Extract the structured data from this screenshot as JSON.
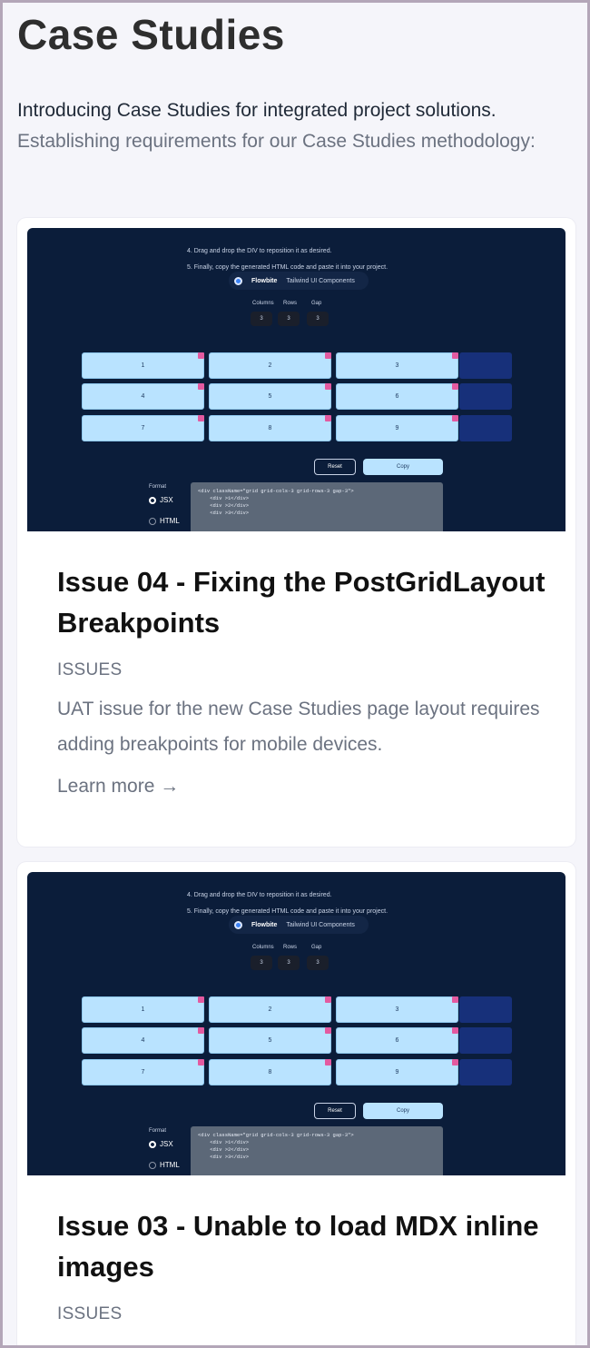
{
  "page": {
    "title": "Case Studies",
    "intro_lead": "Introducing Case Studies for integrated project solutions.",
    "intro_muted": "Establishing requirements for our Case Studies methodology:"
  },
  "screenshot": {
    "step4": "4. Drag and drop the DIV to reposition it as desired.",
    "step5": "5. Finally, copy the generated HTML code and paste it into your project.",
    "toggle_active": "Flowbite",
    "toggle_alt": "Tailwind UI Components",
    "label_columns": "Columns",
    "label_rows": "Rows",
    "label_gap": "Gap",
    "columns": "3",
    "rows": "3",
    "gap": "3",
    "cells": [
      "1",
      "2",
      "3",
      "4",
      "5",
      "6",
      "7",
      "8",
      "9"
    ],
    "reset_label": "Reset",
    "copy_label": "Copy",
    "format_label": "Format",
    "format_jsx": "JSX",
    "format_html": "HTML",
    "code": "<div className=\"grid grid-cols-3 grid-rows-3 gap-3\">\n    <div >1</div>\n    <div >2</div>\n    <div >3</div>"
  },
  "posts": [
    {
      "title": "Issue 04 - Fixing the PostGridLayout Breakpoints",
      "category": "ISSUES",
      "description": "UAT issue for the new Case Studies page layout requires adding breakpoints for mobile devices.",
      "link": "Learn more →"
    },
    {
      "title": "Issue 03 - Unable to load MDX inline images",
      "category": "ISSUES"
    }
  ],
  "colors": {
    "background": "#f5f5fa",
    "card": "#ffffff",
    "screenshot_bg": "#0b1d3a",
    "grid_cell": "#b9e3ff",
    "muted_text": "#6b7280"
  }
}
